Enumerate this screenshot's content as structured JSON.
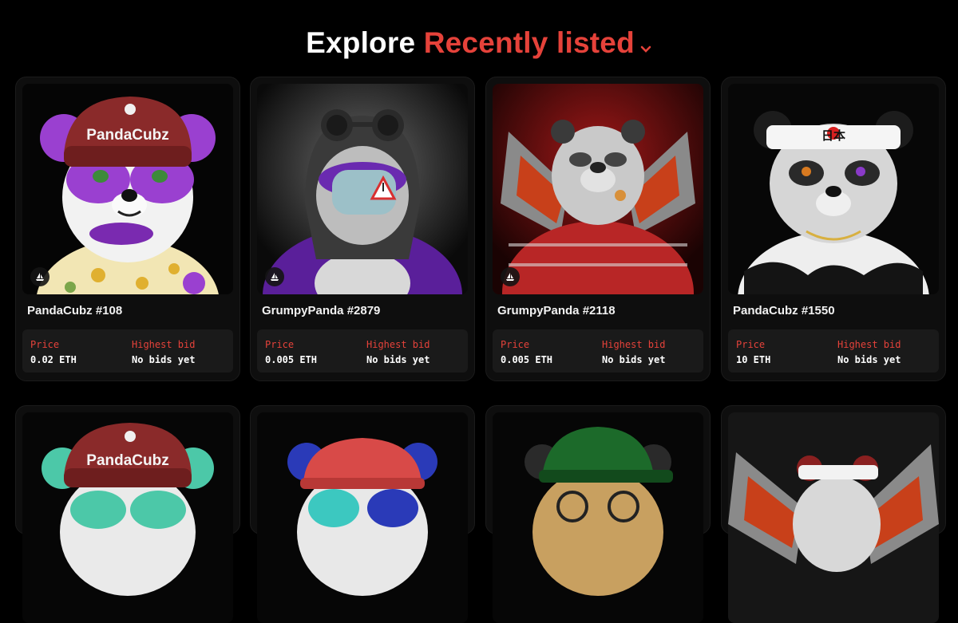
{
  "header": {
    "prefix": "Explore",
    "filter": "Recently listed",
    "accent_color": "#e5423a"
  },
  "labels": {
    "price": "Price",
    "highest_bid": "Highest bid"
  },
  "cards": [
    {
      "name": "PandaCubz #108",
      "price": "0.02 ETH",
      "highest_bid": "No bids yet",
      "chain_icon": "sailboat-icon"
    },
    {
      "name": "GrumpyPanda #2879",
      "price": "0.005 ETH",
      "highest_bid": "No bids yet",
      "chain_icon": "sailboat-icon"
    },
    {
      "name": "GrumpyPanda #2118",
      "price": "0.005 ETH",
      "highest_bid": "No bids yet",
      "chain_icon": "sailboat-icon"
    },
    {
      "name": "PandaCubz #1550",
      "price": "10 ETH",
      "highest_bid": "No bids yet",
      "chain_icon": "sailboat-icon"
    }
  ],
  "art_text": {
    "beanie_1": "PandaCubz",
    "beanie_5": "PandaCubz",
    "headband_4": "日本"
  }
}
